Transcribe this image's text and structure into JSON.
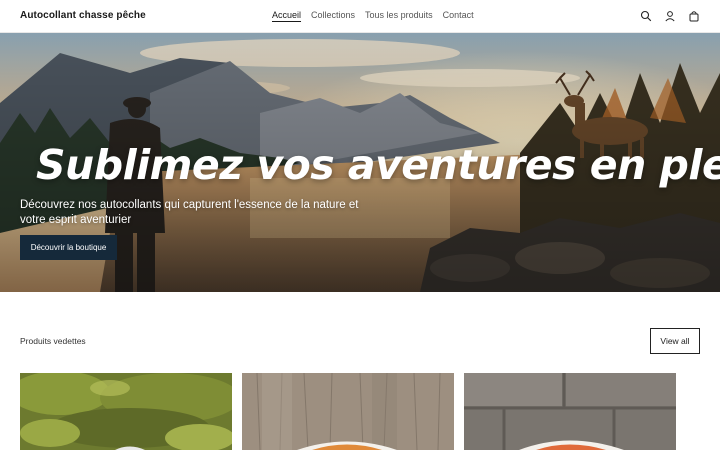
{
  "header": {
    "brand": "Autocollant chasse pêche",
    "nav": [
      {
        "label": "Accueil",
        "active": true
      },
      {
        "label": "Collections",
        "active": false
      },
      {
        "label": "Tous les produits",
        "active": false
      },
      {
        "label": "Contact",
        "active": false
      }
    ],
    "icons": [
      "search-icon",
      "account-icon",
      "cart-icon"
    ]
  },
  "hero": {
    "title": "Sublimez vos aventures en plein air",
    "subtitle": "Découvrez nos autocollants qui capturent l'essence de la nature et votre esprit aventurier",
    "button_label": "Découvrir la boutique"
  },
  "featured": {
    "title": "Produits vedettes",
    "view_all_label": "View all"
  },
  "colors": {
    "button_dark": "#15293a",
    "text": "#1f1f1f"
  }
}
